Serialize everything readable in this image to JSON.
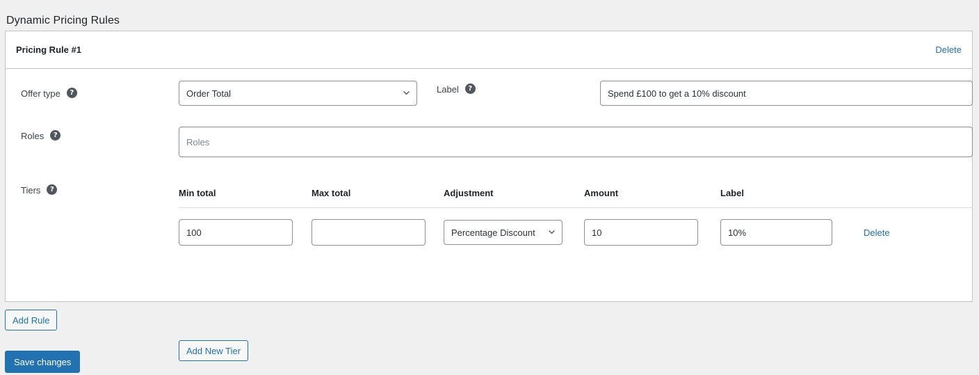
{
  "page": {
    "title": "Dynamic Pricing Rules"
  },
  "rule": {
    "header_title": "Pricing Rule #1",
    "delete_label": "Delete",
    "fields": {
      "offer_type": {
        "label": "Offer type",
        "help_icon": "help-icon",
        "value": "Order Total",
        "options": [
          "Order Total"
        ]
      },
      "label": {
        "label": "Label",
        "help_icon": "help-icon",
        "value": "Spend £100 to get a 10% discount",
        "placeholder": ""
      },
      "roles": {
        "label": "Roles",
        "help_icon": "help-icon",
        "placeholder": "Roles",
        "value": ""
      },
      "tiers": {
        "label": "Tiers",
        "help_icon": "help-icon"
      }
    }
  },
  "tiers_table": {
    "columns": [
      "Min total",
      "Max total",
      "Adjustment",
      "Amount",
      "Label",
      ""
    ],
    "rows": [
      {
        "min_total": "100",
        "max_total": "",
        "adjustment": "Percentage Discount",
        "adjustment_options": [
          "Percentage Discount"
        ],
        "amount": "10",
        "label": "10%",
        "delete_label": "Delete"
      }
    ],
    "add_tier_label": "Add New Tier"
  },
  "footer": {
    "add_rule_label": "Add Rule",
    "save_changes_label": "Save changes"
  },
  "colors": {
    "page_background": "#f0f0f1",
    "card_background": "#ffffff",
    "border": "#c3c4c7",
    "accent_blue": "#2271b1",
    "text": "#3c434a",
    "heading": "#1d2327",
    "placeholder": "#7c8794",
    "helptip": "#50575e"
  }
}
